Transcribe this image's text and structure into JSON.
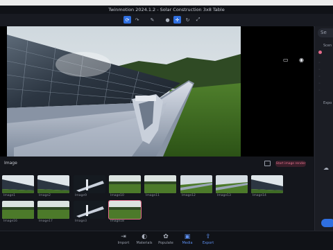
{
  "window": {
    "title": "Twinmotion 2024.1.2 - Solar Construction 3x8 Table"
  },
  "toolbar": {
    "icons": [
      "orbit-icon",
      "redo-icon",
      "pen-icon",
      "sphere-icon",
      "move-icon",
      "rotate-icon",
      "scale-icon"
    ],
    "active_icon": "move-icon"
  },
  "viewport": {
    "icons": [
      "panel-icon",
      "eye-icon"
    ],
    "scene": "solar panels on tracker rail over grass field"
  },
  "right_panel": {
    "search_text": "Se",
    "scene_label": "Scen",
    "export_label": "Expo"
  },
  "media": {
    "section_title": "Image",
    "create_button": "Start image render",
    "thumbnails": [
      {
        "label": "Image1",
        "variant": "panels"
      },
      {
        "label": "Image2",
        "variant": "panels"
      },
      {
        "label": "Image9",
        "variant": "dark"
      },
      {
        "label": "Image10",
        "variant": "grass"
      },
      {
        "label": "Image11",
        "variant": "grass"
      },
      {
        "label": "Image12",
        "variant": "rail"
      },
      {
        "label": "Image13",
        "variant": "rail"
      },
      {
        "label": "Image14",
        "variant": "panels"
      },
      {
        "label": "Image16",
        "variant": "grass"
      },
      {
        "label": "Image17",
        "variant": "grass"
      },
      {
        "label": "Image3",
        "variant": "dark"
      },
      {
        "label": "Image18",
        "variant": "grass"
      }
    ],
    "selected_index": 11
  },
  "bottom_nav": {
    "items": [
      {
        "label": "Import",
        "icon": "import-icon"
      },
      {
        "label": "Materials",
        "icon": "materials-icon"
      },
      {
        "label": "Populate",
        "icon": "populate-icon"
      },
      {
        "label": "Media",
        "icon": "media-icon"
      },
      {
        "label": "Export",
        "icon": "export-icon"
      }
    ],
    "active": "Media"
  },
  "colors": {
    "accent": "#2f6fe0",
    "render_button": "#e8748f",
    "panel_bg": "#14161c"
  }
}
